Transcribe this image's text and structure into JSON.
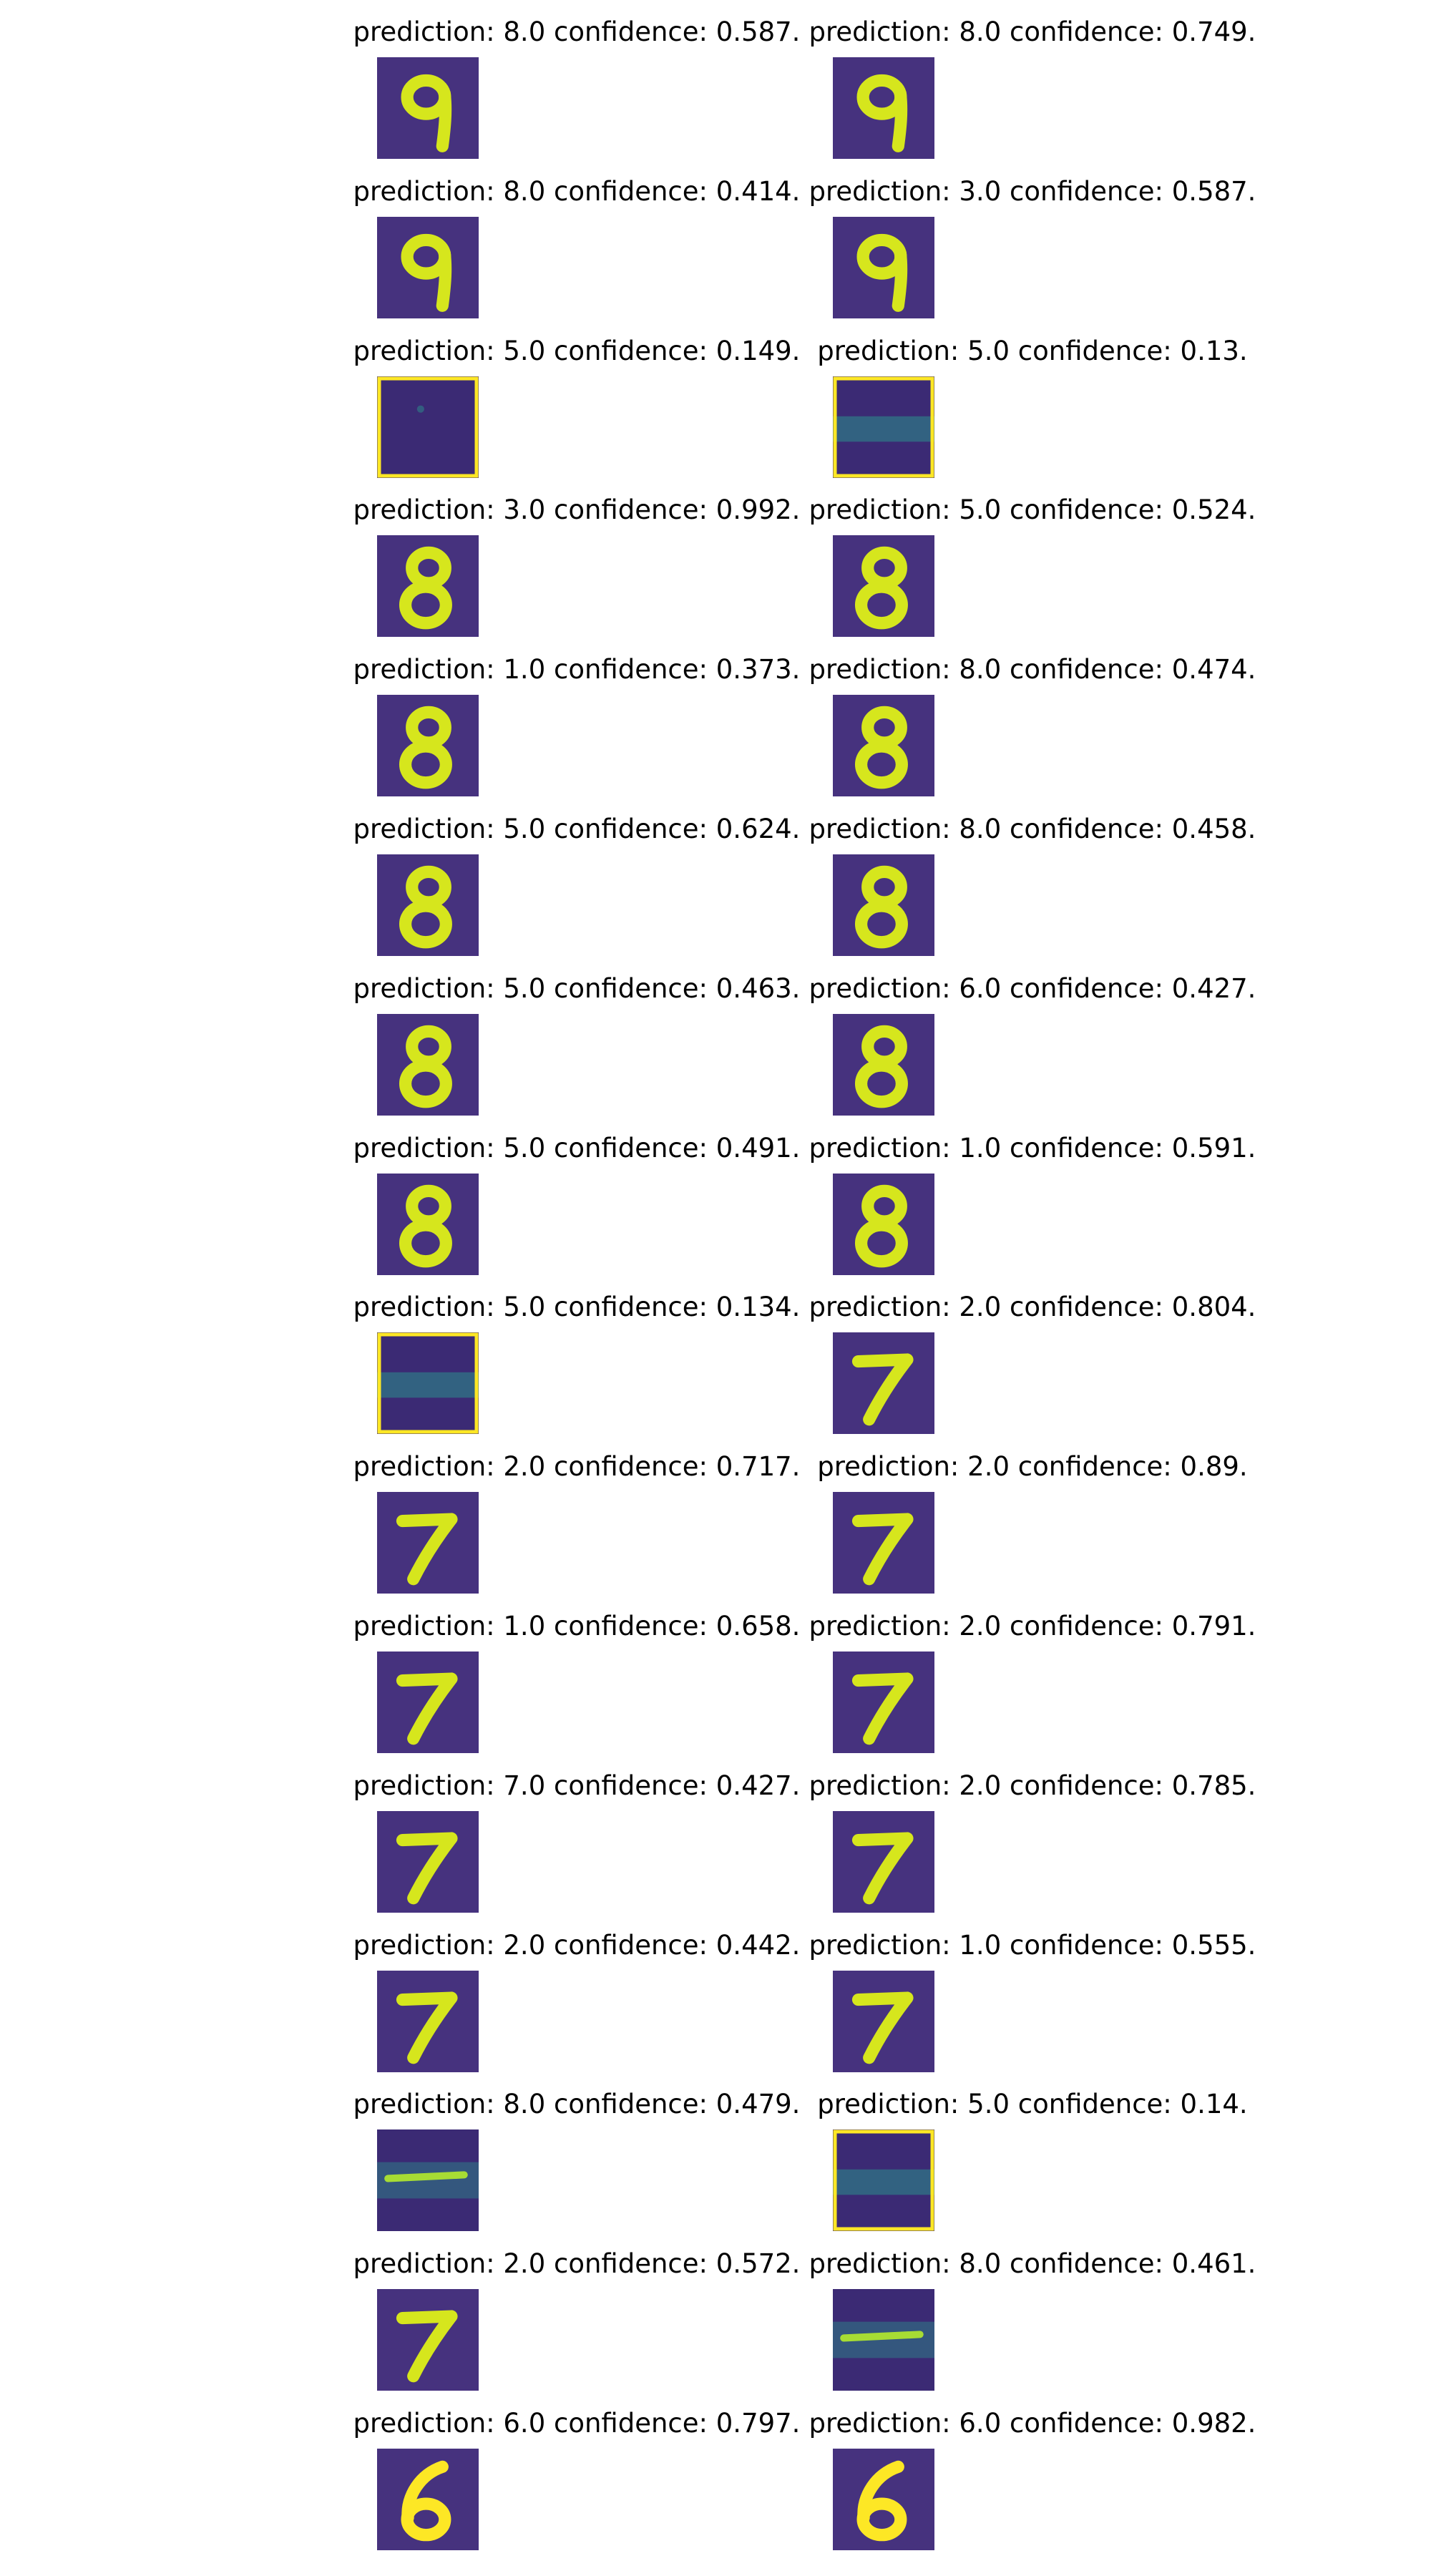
{
  "figure": {
    "columns": 2,
    "rows": 16
  },
  "palette": {
    "background": "#46327e",
    "background_dark": "#3b2a74",
    "mid": "#2c8f8c",
    "stroke": "#a7dc34",
    "stroke_bright": "#d6e61d",
    "bright": "#fde725"
  },
  "panels": [
    {
      "prediction": "8.0",
      "confidence": "0.587",
      "caption": "prediction: 8.0 confidence: 0.587.",
      "image": "digit-9"
    },
    {
      "prediction": "8.0",
      "confidence": "0.749",
      "caption": "prediction: 8.0 confidence: 0.749.",
      "image": "digit-9"
    },
    {
      "prediction": "8.0",
      "confidence": "0.414",
      "caption": "prediction: 8.0 confidence: 0.414.",
      "image": "digit-9"
    },
    {
      "prediction": "3.0",
      "confidence": "0.587",
      "caption": "prediction: 3.0 confidence: 0.587.",
      "image": "digit-9"
    },
    {
      "prediction": "5.0",
      "confidence": "0.149",
      "caption": "prediction: 5.0 confidence: 0.149.",
      "image": "noise"
    },
    {
      "prediction": "5.0",
      "confidence": "0.13",
      "caption": "prediction: 5.0 confidence: 0.13.",
      "image": "noise-band"
    },
    {
      "prediction": "3.0",
      "confidence": "0.992",
      "caption": "prediction: 3.0 confidence: 0.992.",
      "image": "digit-8"
    },
    {
      "prediction": "5.0",
      "confidence": "0.524",
      "caption": "prediction: 5.0 confidence: 0.524.",
      "image": "digit-8"
    },
    {
      "prediction": "1.0",
      "confidence": "0.373",
      "caption": "prediction: 1.0 confidence: 0.373.",
      "image": "digit-8"
    },
    {
      "prediction": "8.0",
      "confidence": "0.474",
      "caption": "prediction: 8.0 confidence: 0.474.",
      "image": "digit-8"
    },
    {
      "prediction": "5.0",
      "confidence": "0.624",
      "caption": "prediction: 5.0 confidence: 0.624.",
      "image": "digit-8"
    },
    {
      "prediction": "8.0",
      "confidence": "0.458",
      "caption": "prediction: 8.0 confidence: 0.458.",
      "image": "digit-8"
    },
    {
      "prediction": "5.0",
      "confidence": "0.463",
      "caption": "prediction: 5.0 confidence: 0.463.",
      "image": "digit-8"
    },
    {
      "prediction": "6.0",
      "confidence": "0.427",
      "caption": "prediction: 6.0 confidence: 0.427.",
      "image": "digit-8"
    },
    {
      "prediction": "5.0",
      "confidence": "0.491",
      "caption": "prediction: 5.0 confidence: 0.491.",
      "image": "digit-8"
    },
    {
      "prediction": "1.0",
      "confidence": "0.591",
      "caption": "prediction: 1.0 confidence: 0.591.",
      "image": "digit-8"
    },
    {
      "prediction": "5.0",
      "confidence": "0.134",
      "caption": "prediction: 5.0 confidence: 0.134.",
      "image": "noise-band"
    },
    {
      "prediction": "2.0",
      "confidence": "0.804",
      "caption": "prediction: 2.0 confidence: 0.804.",
      "image": "digit-7"
    },
    {
      "prediction": "2.0",
      "confidence": "0.717",
      "caption": "prediction: 2.0 confidence: 0.717.",
      "image": "digit-7"
    },
    {
      "prediction": "2.0",
      "confidence": "0.89",
      "caption": "prediction: 2.0 confidence: 0.89.",
      "image": "digit-7"
    },
    {
      "prediction": "1.0",
      "confidence": "0.658",
      "caption": "prediction: 1.0 confidence: 0.658.",
      "image": "digit-7"
    },
    {
      "prediction": "2.0",
      "confidence": "0.791",
      "caption": "prediction: 2.0 confidence: 0.791.",
      "image": "digit-7"
    },
    {
      "prediction": "7.0",
      "confidence": "0.427",
      "caption": "prediction: 7.0 confidence: 0.427.",
      "image": "digit-7"
    },
    {
      "prediction": "2.0",
      "confidence": "0.785",
      "caption": "prediction: 2.0 confidence: 0.785.",
      "image": "digit-7"
    },
    {
      "prediction": "2.0",
      "confidence": "0.442",
      "caption": "prediction: 2.0 confidence: 0.442.",
      "image": "digit-7"
    },
    {
      "prediction": "1.0",
      "confidence": "0.555",
      "caption": "prediction: 1.0 confidence: 0.555.",
      "image": "digit-7"
    },
    {
      "prediction": "8.0",
      "confidence": "0.479",
      "caption": "prediction: 8.0 confidence: 0.479.",
      "image": "noise-stroke"
    },
    {
      "prediction": "5.0",
      "confidence": "0.14",
      "caption": "prediction: 5.0 confidence: 0.14.",
      "image": "noise-band"
    },
    {
      "prediction": "2.0",
      "confidence": "0.572",
      "caption": "prediction: 2.0 confidence: 0.572.",
      "image": "digit-7"
    },
    {
      "prediction": "8.0",
      "confidence": "0.461",
      "caption": "prediction: 8.0 confidence: 0.461.",
      "image": "noise-stroke"
    },
    {
      "prediction": "6.0",
      "confidence": "0.797",
      "caption": "prediction: 6.0 confidence: 0.797.",
      "image": "digit-6"
    },
    {
      "prediction": "6.0",
      "confidence": "0.982",
      "caption": "prediction: 6.0 confidence: 0.982.",
      "image": "digit-6"
    }
  ]
}
